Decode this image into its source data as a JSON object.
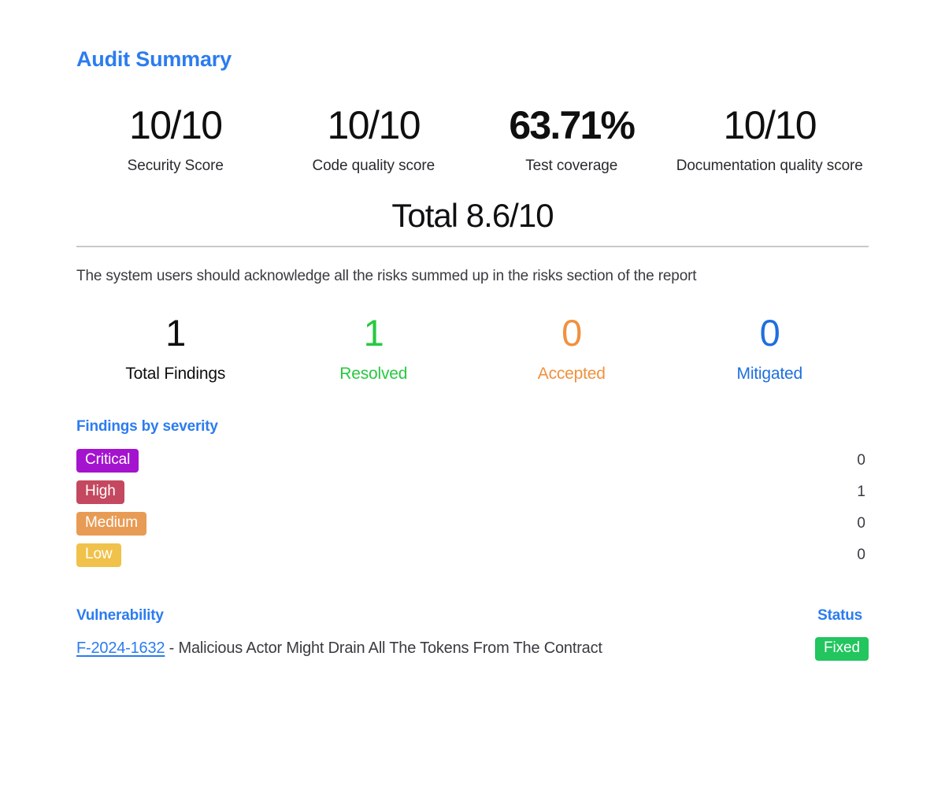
{
  "report": {
    "title": "Audit Summary",
    "scores": [
      {
        "value": "10/10",
        "label": "Security Score",
        "emphasis": "normal"
      },
      {
        "value": "10/10",
        "label": "Code quality score",
        "emphasis": "normal"
      },
      {
        "value": "63.71%",
        "label": "Test coverage",
        "emphasis": "heavy"
      },
      {
        "value": "10/10",
        "label": "Documentation quality score",
        "emphasis": "normal"
      }
    ],
    "total_label": "Total 8.6/10",
    "note": "The system users should acknowledge all the risks summed up in the risks section of the report",
    "counters": [
      {
        "value": "1",
        "label": "Total Findings",
        "color": "#0f0f10"
      },
      {
        "value": "1",
        "label": "Resolved",
        "color": "#28c940"
      },
      {
        "value": "0",
        "label": "Accepted",
        "color": "#f0913e"
      },
      {
        "value": "0",
        "label": "Mitigated",
        "color": "#1e6fe0"
      }
    ],
    "severity": {
      "title": "Findings by severity",
      "rows": [
        {
          "label": "Critical",
          "count": "0",
          "color": "#a413ce"
        },
        {
          "label": "High",
          "count": "1",
          "color": "#c4485f"
        },
        {
          "label": "Medium",
          "count": "0",
          "color": "#e89b54"
        },
        {
          "label": "Low",
          "count": "0",
          "color": "#f0c24b"
        }
      ]
    },
    "vulnerabilities": {
      "col_vulnerability": "Vulnerability",
      "col_status": "Status",
      "rows": [
        {
          "id": "F-2024-1632",
          "separator": " - ",
          "title": "Malicious Actor Might Drain All The Tokens From The Contract",
          "status": "Fixed",
          "status_color": "#22c55e"
        }
      ]
    }
  }
}
